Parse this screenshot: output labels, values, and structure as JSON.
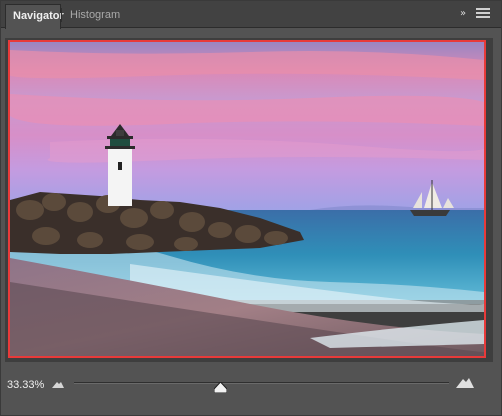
{
  "panel": {
    "tabs": [
      {
        "label": "Navigator",
        "active": true
      },
      {
        "label": "Histogram",
        "active": false
      }
    ],
    "collapse_label": "»",
    "menu_icon": "hamburger-menu-icon"
  },
  "navigator": {
    "frame_color": "#e83a3a",
    "image_description_icon": "photo-thumbnail"
  },
  "zoom": {
    "value": "33.33%",
    "slider_fraction": 0.39,
    "zoom_out_icon": "small-mountain-icon",
    "zoom_in_icon": "large-mountain-icon"
  }
}
